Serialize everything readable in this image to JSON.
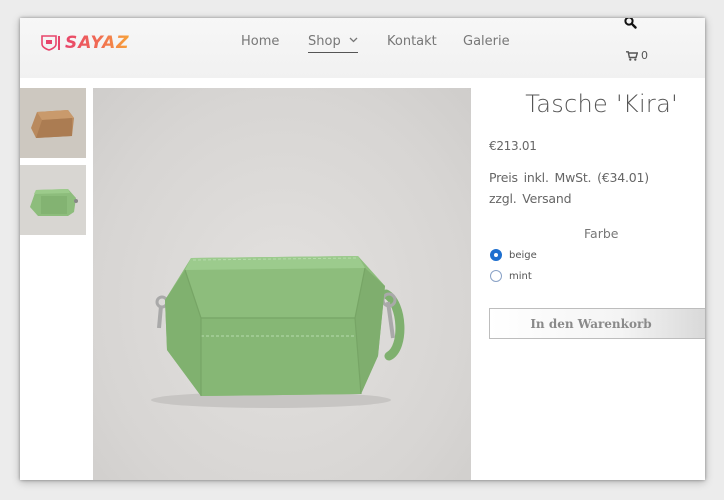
{
  "brand": {
    "name": "SAYAZ",
    "gradient": [
      "#e8456b",
      "#f7a339"
    ]
  },
  "nav": {
    "items": [
      {
        "label": "Home"
      },
      {
        "label": "Shop"
      },
      {
        "label": "Kontakt"
      },
      {
        "label": "Galerie"
      }
    ],
    "active": "Shop"
  },
  "header_icons": {
    "search": "search-icon",
    "cart": "cart-icon"
  },
  "cart": {
    "count": "0"
  },
  "gallery": {
    "thumbnails": [
      {
        "color": "beige",
        "icon": "bag-photo"
      },
      {
        "color": "mint",
        "icon": "bag-photo"
      }
    ],
    "main_image": {
      "color": "mint",
      "bag_color": "#8dbd7c"
    }
  },
  "product": {
    "title": "Tasche 'Kira'",
    "price": "€213.01",
    "tax_line1": "Preis inkl. MwSt. (€34.01)",
    "tax_line2": "zzgl. Versand",
    "color_label": "Farbe",
    "options": [
      {
        "label": "beige",
        "selected": true
      },
      {
        "label": "mint",
        "selected": false
      }
    ],
    "add_to_cart": "In den Warenkorb"
  },
  "colors": {
    "accent": "#1e6fcf",
    "text": "#666666",
    "page_bg": "#ececec"
  }
}
